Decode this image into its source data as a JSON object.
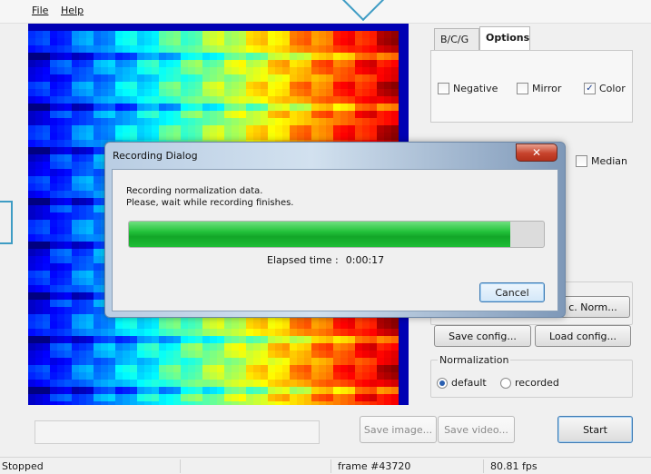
{
  "menu": {
    "file": "File",
    "help": "Help"
  },
  "tabs": [
    {
      "label": "B/C/G"
    },
    {
      "label": "Options",
      "active": true
    }
  ],
  "options": {
    "negative": {
      "label": "Negative",
      "checked": false
    },
    "mirror": {
      "label": "Mirror",
      "checked": false
    },
    "color": {
      "label": "Color",
      "checked": true
    },
    "median": {
      "label": "Median",
      "checked": false
    }
  },
  "buttons": {
    "calc_norm": "c. Norm...",
    "save_config": "Save config...",
    "load_config": "Load config...",
    "save_image": "Save image...",
    "save_video": "Save video...",
    "start": "Start"
  },
  "normalization": {
    "title": "Normalization",
    "options": [
      {
        "label": "default",
        "selected": true
      },
      {
        "label": "recorded",
        "selected": false
      }
    ]
  },
  "status": {
    "state": "Stopped",
    "frame": "frame #43720",
    "fps": "80.81 fps"
  },
  "dialog": {
    "title": "Recording Dialog",
    "close_glyph": "✕",
    "line1": "Recording normalization data.",
    "line2": "Please, wait while recording finishes.",
    "progress": 0.92,
    "elapsed_label": "Elapsed time :",
    "elapsed_value": "0:00:17",
    "cancel": "Cancel"
  },
  "colors": {
    "accent": "#3e9cc4",
    "progress_green": "#1fbe36",
    "dialog_frame": "#b9cde3",
    "close_red": "#c7432c"
  },
  "icons": {
    "checkmark": "check-icon",
    "close": "close-icon",
    "radio": "radio-icon"
  }
}
